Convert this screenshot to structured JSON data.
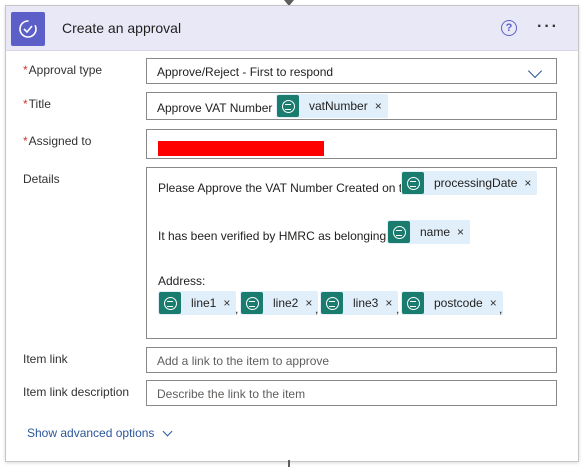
{
  "header": {
    "title": "Create an approval",
    "help_glyph": "?",
    "more_glyph": "···",
    "accent_color": "#5b5fc7"
  },
  "fields": {
    "approval_type": {
      "label": "Approval type",
      "required_mark": "*",
      "value": "Approve/Reject - First to respond"
    },
    "title": {
      "label": "Title",
      "required_mark": "*",
      "prefix_text": "Approve VAT Number :",
      "token": "vatNumber"
    },
    "assigned_to": {
      "label": "Assigned to",
      "required_mark": "*"
    },
    "details": {
      "label": "Details",
      "line1_text": "Please Approve the VAT Number Created on the",
      "line1_token": "processingDate",
      "line2_text": "It has been verified by HMRC as belonging to",
      "line2_token": "name",
      "address_label": "Address:",
      "address_tokens": [
        "line1",
        "line2",
        "line3",
        "postcode"
      ],
      "separator": ",",
      "trailing_comma": ","
    },
    "item_link": {
      "label": "Item link",
      "placeholder": "Add a link to the item to approve"
    },
    "item_link_description": {
      "label": "Item link description",
      "placeholder": "Describe the link to the item"
    }
  },
  "footer": {
    "show_advanced": "Show advanced options"
  },
  "icons": {
    "header": "approval-icon",
    "token": "dynamic-content-icon",
    "remove": "close-icon",
    "remove_glyph": "×"
  }
}
